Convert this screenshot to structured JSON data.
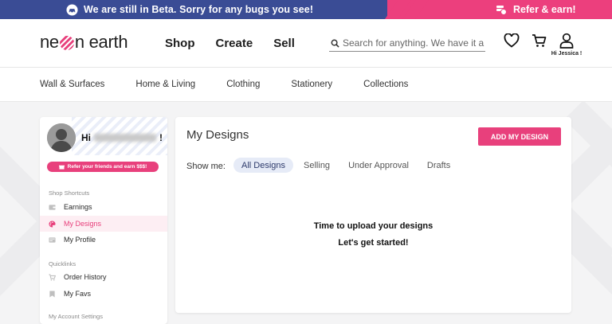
{
  "banner": {
    "message": "We are still in Beta. Sorry for any bugs you see!",
    "refer": "Refer & earn!",
    "bg_color": "#3a4c95",
    "accent_color": "#ec3f7d"
  },
  "header": {
    "logo": {
      "part1": "ne",
      "part2": "n earth"
    },
    "nav": [
      "Shop",
      "Create",
      "Sell"
    ],
    "search_placeholder": "Search for anything. We have it all!",
    "icons": [
      "heart-icon",
      "cart-icon",
      "user-icon"
    ],
    "user_greeting": "Hi Jessica !"
  },
  "categories": [
    "Wall & Surfaces",
    "Home & Living",
    "Clothing",
    "Stationery",
    "Collections"
  ],
  "sidebar": {
    "greeting_prefix": "Hi",
    "greeting_suffix": "!",
    "refer_label": "Refer your friends and earn $$$!",
    "sections": [
      {
        "title": "Shop Shortcuts",
        "items": [
          {
            "label": "Earnings",
            "icon": "wallet-icon"
          },
          {
            "label": "My Designs",
            "icon": "palette-icon",
            "active": true
          },
          {
            "label": "My Profile",
            "icon": "id-card-icon"
          }
        ]
      },
      {
        "title": "Quicklinks",
        "items": [
          {
            "label": "Order History",
            "icon": "cart-icon"
          },
          {
            "label": "My Favs",
            "icon": "bookmark-icon"
          }
        ]
      },
      {
        "title": "My Account Settings",
        "items": []
      }
    ]
  },
  "main": {
    "title": "My Designs",
    "add_button": "ADD MY DESIGN",
    "show_me_label": "Show me:",
    "tabs": [
      {
        "label": "All Designs",
        "active": true
      },
      {
        "label": "Selling"
      },
      {
        "label": "Under Approval"
      },
      {
        "label": "Drafts"
      }
    ],
    "empty_line1": "Time to upload your designs",
    "empty_line2": "Let's get started!"
  },
  "colors": {
    "brand_pink": "#e8407c",
    "active_tab_bg": "#e6ebf7",
    "page_bg": "#f4f4f5"
  }
}
